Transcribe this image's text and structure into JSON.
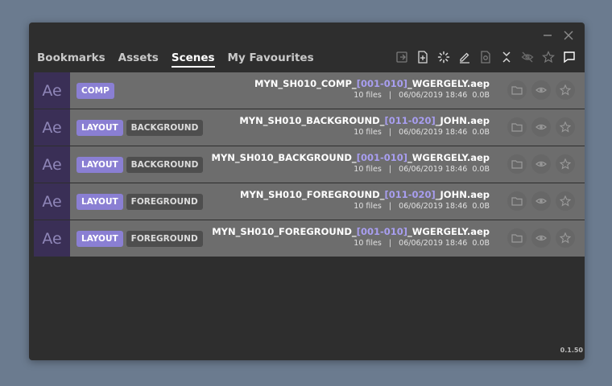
{
  "window": {
    "controls": [
      {
        "name": "minimize-icon",
        "glyph": "minimize"
      },
      {
        "name": "close-icon",
        "glyph": "close"
      }
    ]
  },
  "tabs": [
    {
      "label": "Bookmarks",
      "active": false
    },
    {
      "label": "Assets",
      "active": false
    },
    {
      "label": "Scenes",
      "active": true
    },
    {
      "label": "My Favourites",
      "active": false
    }
  ],
  "toolbar": [
    {
      "name": "import-icon"
    },
    {
      "name": "new-file-icon"
    },
    {
      "name": "loading-icon"
    },
    {
      "name": "edit-icon"
    },
    {
      "name": "search-file-icon"
    },
    {
      "name": "collapse-icon"
    },
    {
      "name": "hide-icon"
    },
    {
      "name": "favourite-icon"
    },
    {
      "name": "comment-icon"
    }
  ],
  "files": [
    {
      "app": "Ae",
      "primary_tag": "COMP",
      "secondary_tag": "",
      "name_prefix": "MYN_SH010_COMP_",
      "range": "[001-010]",
      "name_suffix": "_WGERGELY.aep",
      "files_count": "10 files",
      "date": "06/06/2019 18:46",
      "size": "0.0B"
    },
    {
      "app": "Ae",
      "primary_tag": "LAYOUT",
      "secondary_tag": "BACKGROUND",
      "name_prefix": "MYN_SH010_BACKGROUND_",
      "range": "[011-020]",
      "name_suffix": "_JOHN.aep",
      "files_count": "10 files",
      "date": "06/06/2019 18:46",
      "size": "0.0B"
    },
    {
      "app": "Ae",
      "primary_tag": "LAYOUT",
      "secondary_tag": "BACKGROUND",
      "name_prefix": "MYN_SH010_BACKGROUND_",
      "range": "[001-010]",
      "name_suffix": "_WGERGELY.aep",
      "files_count": "10 files",
      "date": "06/06/2019 18:46",
      "size": "0.0B"
    },
    {
      "app": "Ae",
      "primary_tag": "LAYOUT",
      "secondary_tag": "FOREGROUND",
      "name_prefix": "MYN_SH010_FOREGROUND_",
      "range": "[011-020]",
      "name_suffix": "_JOHN.aep",
      "files_count": "10 files",
      "date": "06/06/2019 18:46",
      "size": "0.0B"
    },
    {
      "app": "Ae",
      "primary_tag": "LAYOUT",
      "secondary_tag": "FOREGROUND",
      "name_prefix": "MYN_SH010_FOREGROUND_",
      "range": "[001-010]",
      "name_suffix": "_WGERGELY.aep",
      "files_count": "10 files",
      "date": "06/06/2019 18:46",
      "size": "0.0B"
    }
  ],
  "meta_separator": "|",
  "row_actions": [
    {
      "name": "folder-icon"
    },
    {
      "name": "eye-icon"
    },
    {
      "name": "star-icon"
    }
  ],
  "version": "0.1.50",
  "colors": {
    "accent": "#8a7fd3",
    "range": "#a89ef0",
    "ae_badge_bg": "#3a2f56",
    "ae_badge_text": "#8f86b8"
  }
}
